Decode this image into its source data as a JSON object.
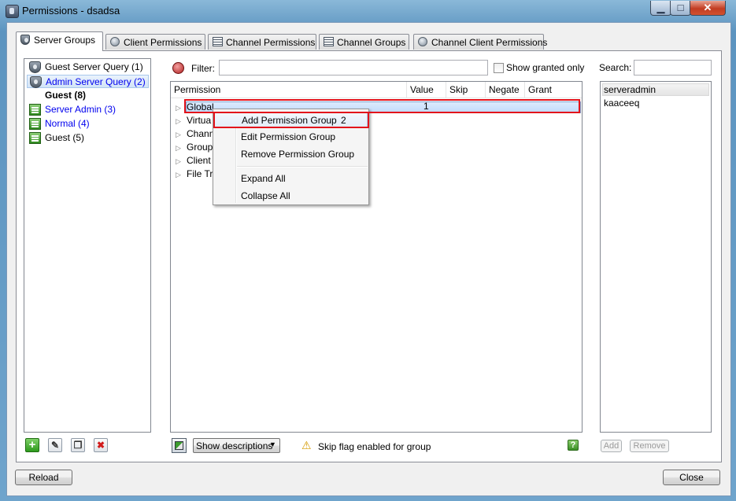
{
  "window": {
    "title": "Permissions - dsadsa",
    "min_glyph": "▁",
    "max_glyph": "□",
    "close_glyph": "✕"
  },
  "tabs": [
    {
      "label": "Server Groups",
      "active": true
    },
    {
      "label": "Client Permissions"
    },
    {
      "label": "Channel Permissions"
    },
    {
      "label": "Channel Groups"
    },
    {
      "label": "Channel Client Permissions"
    }
  ],
  "groups": [
    {
      "label": "Guest Server Query (1)",
      "icon": "shield-icon",
      "style": "normal"
    },
    {
      "label": "Admin Server Query (2)",
      "icon": "shield-icon",
      "style": "link-selected"
    },
    {
      "label": "Guest (8)",
      "icon": "none",
      "style": "bold"
    },
    {
      "label": "Server Admin (3)",
      "icon": "group-icon",
      "style": "link"
    },
    {
      "label": "Normal (4)",
      "icon": "group-icon",
      "style": "link"
    },
    {
      "label": "Guest (5)",
      "icon": "group-icon",
      "style": "normal"
    }
  ],
  "group_toolbar": {
    "add": "+",
    "edit": "✎",
    "copy": "❐",
    "delete": "✖"
  },
  "filter": {
    "label": "Filter:",
    "value": "",
    "show_granted_label": "Show granted only"
  },
  "columns": {
    "permission": "Permission",
    "value": "Value",
    "skip": "Skip",
    "negate": "Negate",
    "grant": "Grant"
  },
  "tree": [
    {
      "label": "Global"
    },
    {
      "label": "Virtua"
    },
    {
      "label": "Chann"
    },
    {
      "label": "Group"
    },
    {
      "label": "Client"
    },
    {
      "label": "File Tr"
    }
  ],
  "tree_arrow": "▷",
  "context_menu": {
    "items": [
      "Add Permission Group",
      "Edit Permission Group",
      "Remove Permission Group",
      "Expand All",
      "Collapse All"
    ]
  },
  "annotations": {
    "one": "1",
    "two": "2"
  },
  "bottom_bar": {
    "show_descriptions": "Show descriptions",
    "dropdown_arrow": "▼",
    "warning_glyph": "⚠",
    "warning": "Skip flag enabled for group",
    "help_glyph": "?"
  },
  "search": {
    "label": "Search:",
    "value": "",
    "clients": [
      "serveradmin",
      "kaaceeq"
    ],
    "add": "Add",
    "remove": "Remove"
  },
  "footer": {
    "reload": "Reload",
    "close": "Close"
  },
  "colors": {
    "link": "#0000ee",
    "accent": "#3399ff",
    "annotation_red": "#e3131b"
  }
}
